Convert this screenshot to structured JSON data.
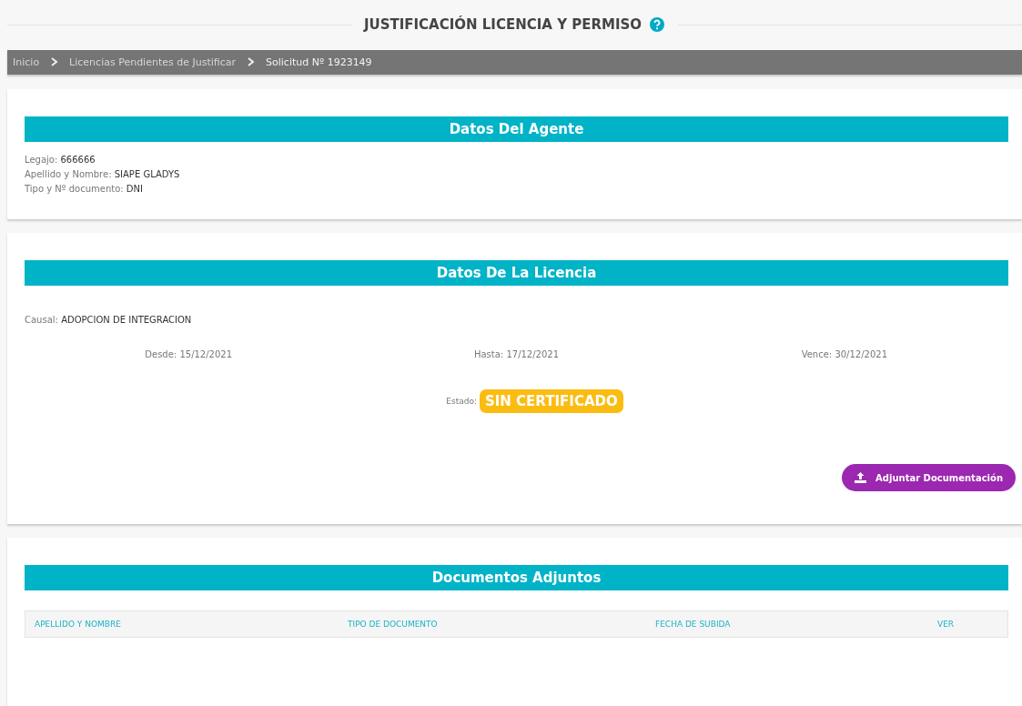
{
  "page": {
    "title": "JUSTIFICACIÓN LICENCIA Y PERMISO"
  },
  "breadcrumb": [
    {
      "label": "Inicio",
      "selected": false
    },
    {
      "label": "Licencias Pendientes de Justificar",
      "selected": false
    },
    {
      "label": "Solicitud Nº 1923149",
      "selected": true
    }
  ],
  "agent": {
    "heading": "Datos Del Agente",
    "fields": [
      {
        "label": "Legajo:",
        "value": "666666"
      },
      {
        "label": "Apellido y Nombre:",
        "value": "SIAPE GLADYS"
      },
      {
        "label": "Tipo y Nº documento:",
        "value": "DNI"
      }
    ]
  },
  "license": {
    "heading": "Datos De La Licencia",
    "cause": {
      "label": "Causal:",
      "value": "ADOPCION DE INTEGRACION"
    },
    "dates": [
      {
        "label": "Desde:",
        "value": "15/12/2021"
      },
      {
        "label": "Hasta:",
        "value": "17/12/2021"
      },
      {
        "label": "Vence:",
        "value": "30/12/2021"
      }
    ],
    "status": {
      "label": "Estado:",
      "value": "SIN CERTIFICADO",
      "color": "#fbbc12"
    },
    "button": "Adjuntar Documentación"
  },
  "documents": {
    "heading": "Documentos Adjuntos",
    "columns": [
      "APELLIDO Y NOMBRE",
      "TIPO DE DOCUMENTO",
      "FECHA DE SUBIDA",
      "VER"
    ]
  }
}
